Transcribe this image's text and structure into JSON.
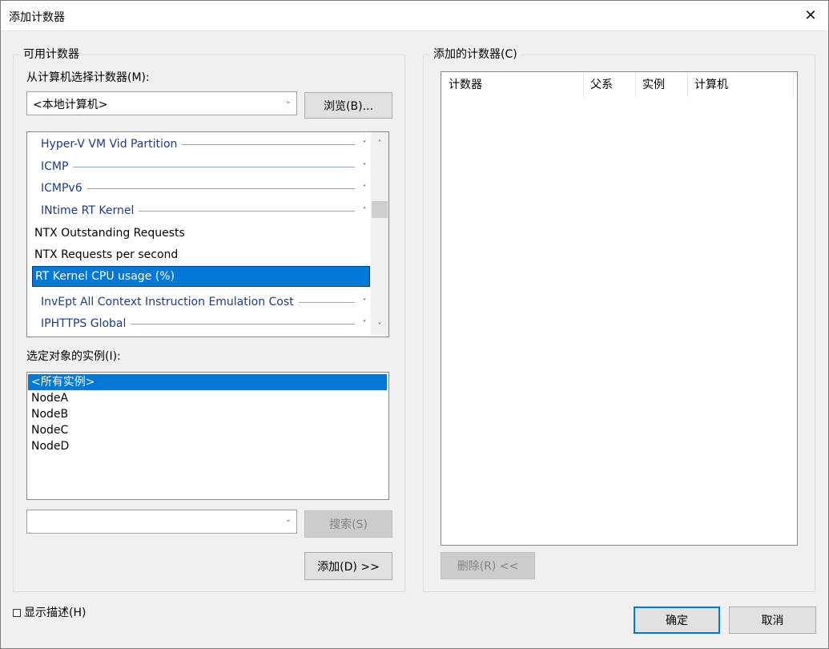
{
  "window": {
    "title": "添加计数器",
    "close_glyph": "✕"
  },
  "available_group": {
    "title": "可用计数器",
    "computer_label": "从计算机选择计数器(M):",
    "computer_value": "<本地计算机>",
    "browse_label": "浏览(B)...",
    "counters": [
      {
        "type": "category",
        "label": "Hyper-V VM Vid Partition",
        "expanded": false
      },
      {
        "type": "category",
        "label": "ICMP",
        "expanded": false
      },
      {
        "type": "category",
        "label": "ICMPv6",
        "expanded": false
      },
      {
        "type": "category",
        "label": "INtime RT Kernel",
        "expanded": true
      },
      {
        "type": "counter",
        "label": "NTX Outstanding Requests",
        "selected": false
      },
      {
        "type": "counter",
        "label": "NTX Requests per second",
        "selected": false
      },
      {
        "type": "counter",
        "label": "RT Kernel CPU usage (%)",
        "selected": true
      },
      {
        "type": "category",
        "label": "InvEpt All Context Instruction Emulation Cost",
        "expanded": false
      },
      {
        "type": "category",
        "label": "IPHTTPS Global",
        "expanded": false
      }
    ],
    "instances_label": "选定对象的实例(I):",
    "instances": [
      {
        "label": "<所有实例>",
        "selected": true
      },
      {
        "label": "NodeA",
        "selected": false
      },
      {
        "label": "NodeB",
        "selected": false
      },
      {
        "label": "NodeC",
        "selected": false
      },
      {
        "label": "NodeD",
        "selected": false
      }
    ],
    "search_value": "",
    "search_label": "搜索(S)",
    "add_label": "添加(D) >>"
  },
  "added_group": {
    "title": "添加的计数器(C)",
    "columns": [
      "计数器",
      "父系",
      "实例",
      "计算机"
    ],
    "remove_label": "删除(R) <<"
  },
  "footer": {
    "show_description_label": "显示描述(H)",
    "ok_label": "确定",
    "cancel_label": "取消"
  },
  "icons": {
    "chevron_down": "˅",
    "chevron_up": "˄",
    "combo_arrow": "⌄"
  },
  "colors": {
    "accent": "#0078d7",
    "category_text": "#1e3a8a"
  }
}
